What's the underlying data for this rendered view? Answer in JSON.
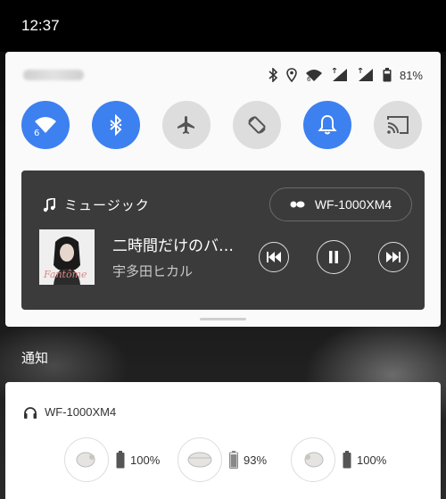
{
  "status_bar": {
    "time": "12:37"
  },
  "quick_settings": {
    "battery_percent": "81%",
    "tiles": [
      {
        "name": "wifi",
        "on": true,
        "sub": "6"
      },
      {
        "name": "bluetooth",
        "on": true
      },
      {
        "name": "airplane",
        "on": false
      },
      {
        "name": "auto-rotate",
        "on": false
      },
      {
        "name": "sound",
        "on": true
      },
      {
        "name": "cast",
        "on": false
      }
    ]
  },
  "media": {
    "app_label": "ミュージック",
    "device_label": "WF-1000XM4",
    "track_title": "二時間だけのバ…",
    "artist": "宇多田ヒカル",
    "album_text": "Fantôme"
  },
  "notifications": {
    "section_title": "通知",
    "card_title": "WF-1000XM4",
    "buds": [
      {
        "name": "left-earbud",
        "battery": "100%"
      },
      {
        "name": "case",
        "battery": "93%"
      },
      {
        "name": "right-earbud",
        "battery": "100%"
      }
    ]
  },
  "colors": {
    "accent": "#3d80f0",
    "media_bg": "#3b3b3b",
    "tile_off": "#dddddd"
  }
}
